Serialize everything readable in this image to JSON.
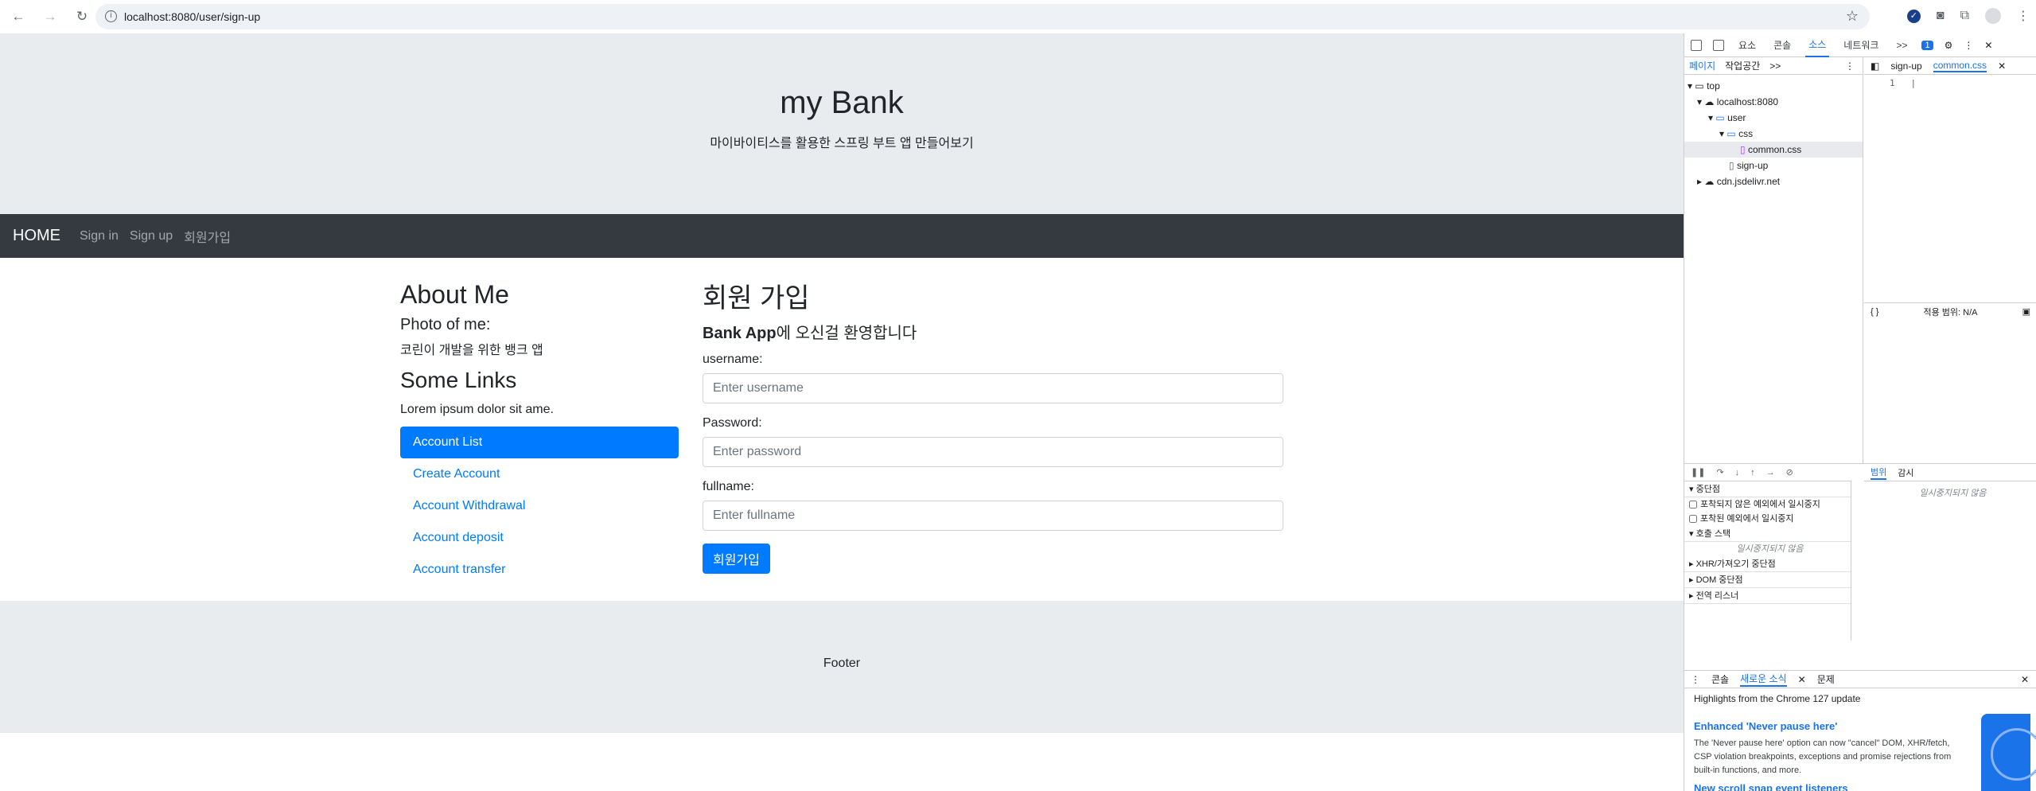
{
  "browser": {
    "url": "localhost:8080/user/sign-up",
    "back_icon": "back-arrow-icon",
    "forward_icon": "forward-arrow-icon",
    "reload_icon": "reload-icon"
  },
  "header": {
    "title": "my Bank",
    "subtitle": "마이바이티스를 활용한 스프링 부트 앱 만들어보기"
  },
  "navbar": {
    "brand": "HOME",
    "links": [
      "Sign in",
      "Sign up",
      "회원가입"
    ]
  },
  "sidebar": {
    "about_title": "About Me",
    "photo_label": "Photo of me:",
    "photo_caption": "코린이 개발을 위한 뱅크 앱",
    "links_title": "Some Links",
    "links_text": "Lorem ipsum dolor sit ame.",
    "items": [
      "Account List",
      "Create Account",
      "Account Withdrawal",
      "Account deposit",
      "Account transfer"
    ],
    "active_index": 0
  },
  "main": {
    "title": "회원 가입",
    "welcome_bold": "Bank App",
    "welcome_rest": "에 오신걸 환영합니다",
    "username_label": "username:",
    "username_placeholder": "Enter username",
    "password_label": "Password:",
    "password_placeholder": "Enter password",
    "fullname_label": "fullname:",
    "fullname_placeholder": "Enter fullname",
    "submit_label": "회원가입"
  },
  "footer": {
    "text": "Footer"
  },
  "devtools": {
    "tabs": [
      "요소",
      "콘솔",
      "소스",
      "네트워크"
    ],
    "active_tab": "소스",
    "more_tabs": ">>",
    "issue_count": "1",
    "left_subtabs": [
      "페이지",
      "작업공간"
    ],
    "left_more": ">>",
    "tree": {
      "top": "top",
      "host": "localhost:8080",
      "user": "user",
      "css": "css",
      "common_css": "common.css",
      "sign_up": "sign-up",
      "cdn": "cdn.jsdelivr.net"
    },
    "editor_tabs": [
      "sign-up",
      "common.css"
    ],
    "active_editor_tab": "common.css",
    "line_number": "1",
    "coverage": "적용 범위: N/A",
    "debugger": {
      "breakpoints_title": "중단점",
      "pause_uncaught": "포착되지 않은 예외에서 일시중지",
      "pause_caught": "포착된 예외에서 일시중지",
      "call_stack_title": "호출 스택",
      "not_paused": "일시중지되지 않음",
      "xhr_bp": "XHR/가져오기 중단점",
      "dom_bp": "DOM 중단점",
      "event_listener": "전역 리스너",
      "scope_tab": "범위",
      "watch_tab": "감시",
      "scope_not_paused": "일시중지되지 않음"
    },
    "drawer": {
      "tabs": [
        "콘솔",
        "새로운 소식",
        "문제"
      ],
      "active_tab": "새로운 소식",
      "highlights": "Highlights from the Chrome 127 update",
      "item1_title": "Enhanced 'Never pause here'",
      "item1_body": "The 'Never pause here' option can now \"cancel\" DOM, XHR/fetch, CSP violation breakpoints, exceptions and promise rejections from built-in functions, and more.",
      "item2_title": "New scroll snap event listeners"
    }
  }
}
